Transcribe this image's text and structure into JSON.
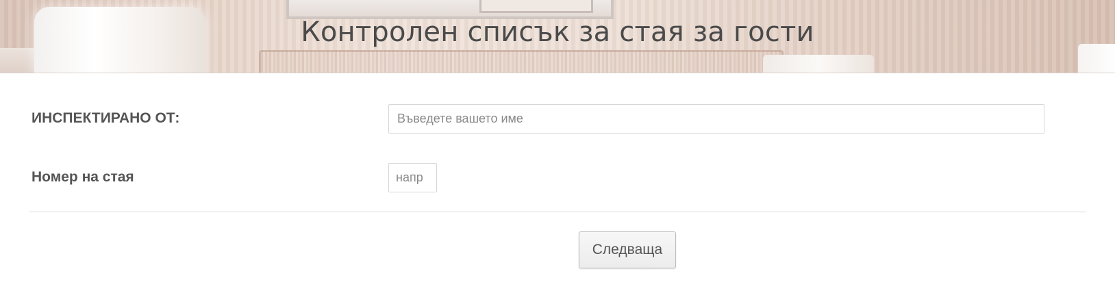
{
  "header": {
    "title": "Контролен списък за стая за гости"
  },
  "form": {
    "inspected_by": {
      "label": "ИНСПЕКТИРАНО ОТ:",
      "value": "",
      "placeholder": "Въведете вашето име"
    },
    "room_number": {
      "label": "Номер на стая",
      "value": "",
      "placeholder": "напр"
    }
  },
  "actions": {
    "next_label": "Следваща"
  }
}
